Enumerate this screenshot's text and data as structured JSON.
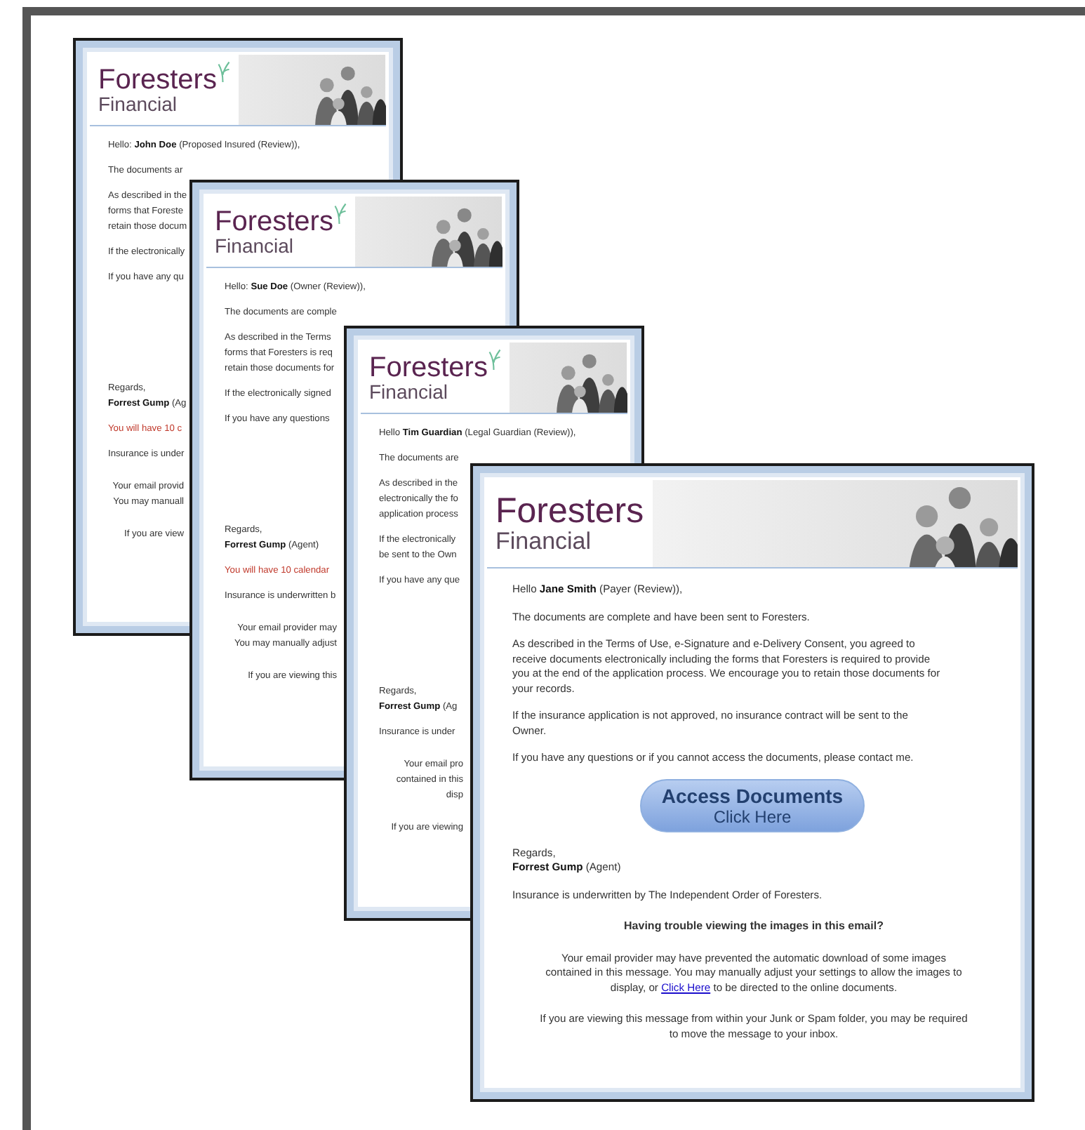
{
  "emails": [
    {
      "brand": "Foresters",
      "subbrand": "Financial",
      "sprout": true,
      "has_picture": true,
      "blocks": [
        {
          "kind": "para",
          "lines": [
            "Hello: **John Doe** (Proposed Insured (Review)),"
          ]
        },
        {
          "kind": "para",
          "lines": [
            "The documents ar"
          ]
        },
        {
          "kind": "para",
          "lines": [
            "As described in the",
            "forms that Foreste",
            "retain those docum"
          ]
        },
        {
          "kind": "para",
          "lines": [
            "If the electronically"
          ]
        },
        {
          "kind": "para",
          "lines": [
            "If you have any qu"
          ]
        },
        {
          "kind": "signoff",
          "lines": [
            "Regards,",
            "**Forrest Gump** (Ag"
          ]
        },
        {
          "kind": "notice",
          "lines": [
            "You will have 10 c"
          ]
        },
        {
          "kind": "para",
          "lines": [
            "Insurance is under"
          ]
        },
        {
          "kind": "footer",
          "lines": [
            "Your email provid",
            "You may manuall"
          ]
        },
        {
          "kind": "footer",
          "lines": [
            "If you are view"
          ]
        }
      ]
    },
    {
      "brand": "Foresters",
      "subbrand": "Financial",
      "sprout": true,
      "has_picture": true,
      "blocks": [
        {
          "kind": "para",
          "lines": [
            "Hello: **Sue Doe** (Owner (Review)),"
          ]
        },
        {
          "kind": "para",
          "lines": [
            "The documents are comple"
          ]
        },
        {
          "kind": "para",
          "lines": [
            "As described in the Terms",
            "forms that Foresters is req",
            "retain those documents for"
          ]
        },
        {
          "kind": "para",
          "lines": [
            "If the electronically signed"
          ]
        },
        {
          "kind": "para",
          "lines": [
            "If you have any questions"
          ]
        },
        {
          "kind": "signoff",
          "lines": [
            "Regards,",
            "**Forrest Gump** (Agent)"
          ]
        },
        {
          "kind": "notice",
          "lines": [
            "You will have 10 calendar"
          ]
        },
        {
          "kind": "para",
          "lines": [
            "Insurance is underwritten b"
          ]
        },
        {
          "kind": "footer",
          "lines": [
            "Your email provider may",
            "You may manually adjust"
          ]
        },
        {
          "kind": "footer",
          "lines": [
            "If you are viewing this"
          ]
        }
      ]
    },
    {
      "brand": "Foresters",
      "subbrand": "Financial",
      "sprout": true,
      "has_picture": true,
      "blocks": [
        {
          "kind": "para",
          "lines": [
            "Hello **Tim Guardian** (Legal Guardian (Review)),"
          ]
        },
        {
          "kind": "para",
          "lines": [
            "The documents are"
          ]
        },
        {
          "kind": "para",
          "lines": [
            "As described in the",
            "electronically the fo",
            "application process"
          ]
        },
        {
          "kind": "para",
          "lines": [
            "If the electronically",
            "be sent to the Own"
          ]
        },
        {
          "kind": "para",
          "lines": [
            "If you have any que"
          ]
        },
        {
          "kind": "signoff",
          "lines": [
            "Regards,",
            "**Forrest Gump** (Ag"
          ]
        },
        {
          "kind": "para",
          "lines": [
            "Insurance is under"
          ]
        },
        {
          "kind": "footer",
          "lines": [
            "Your email pro",
            "contained in this",
            "disp"
          ]
        },
        {
          "kind": "footer",
          "lines": [
            "If you are viewing"
          ]
        }
      ]
    },
    {
      "brand": "Foresters",
      "subbrand": "Financial",
      "sprout": false,
      "has_picture": true,
      "blocks": [
        {
          "kind": "para",
          "lines": [
            "Hello **Jane  Smith** (Payer (Review)),"
          ]
        },
        {
          "kind": "para",
          "lines": [
            "The documents are complete and have been sent to Foresters."
          ]
        },
        {
          "kind": "para",
          "lines": [
            "As described in the Terms of Use, e-Signature and e-Delivery Consent, you agreed to",
            "receive documents electronically including the forms that Foresters is required to provide",
            "you at the end of the application process. We encourage you to retain those documents for",
            "your records."
          ]
        },
        {
          "kind": "para",
          "lines": [
            "If the insurance application is not approved, no insurance contract will be sent to the",
            "Owner."
          ]
        },
        {
          "kind": "para",
          "lines": [
            "If you have any questions or if you cannot access the documents, please contact me."
          ]
        },
        {
          "kind": "button",
          "title": "Access Documents",
          "subtitle": "Click Here"
        },
        {
          "kind": "signoff",
          "lines": [
            "Regards,",
            "**Forrest Gump** (Agent)"
          ]
        },
        {
          "kind": "para",
          "lines": [
            "Insurance is underwritten by The Independent Order of Foresters."
          ]
        },
        {
          "kind": "heading",
          "lines": [
            "Having trouble viewing the images in this email?"
          ]
        },
        {
          "kind": "footer",
          "lines": [
            "Your email provider may have prevented the automatic download of some images",
            "contained in this message. You may manually adjust your settings to allow the images to",
            {
              "before": "display, or ",
              "link": "Click Here",
              "after": " to be directed to the online documents."
            }
          ]
        },
        {
          "kind": "footer",
          "lines": [
            "If you are viewing this message from within your Junk or Spam folder, you may be required",
            "to move the message to your inbox."
          ]
        }
      ]
    }
  ]
}
